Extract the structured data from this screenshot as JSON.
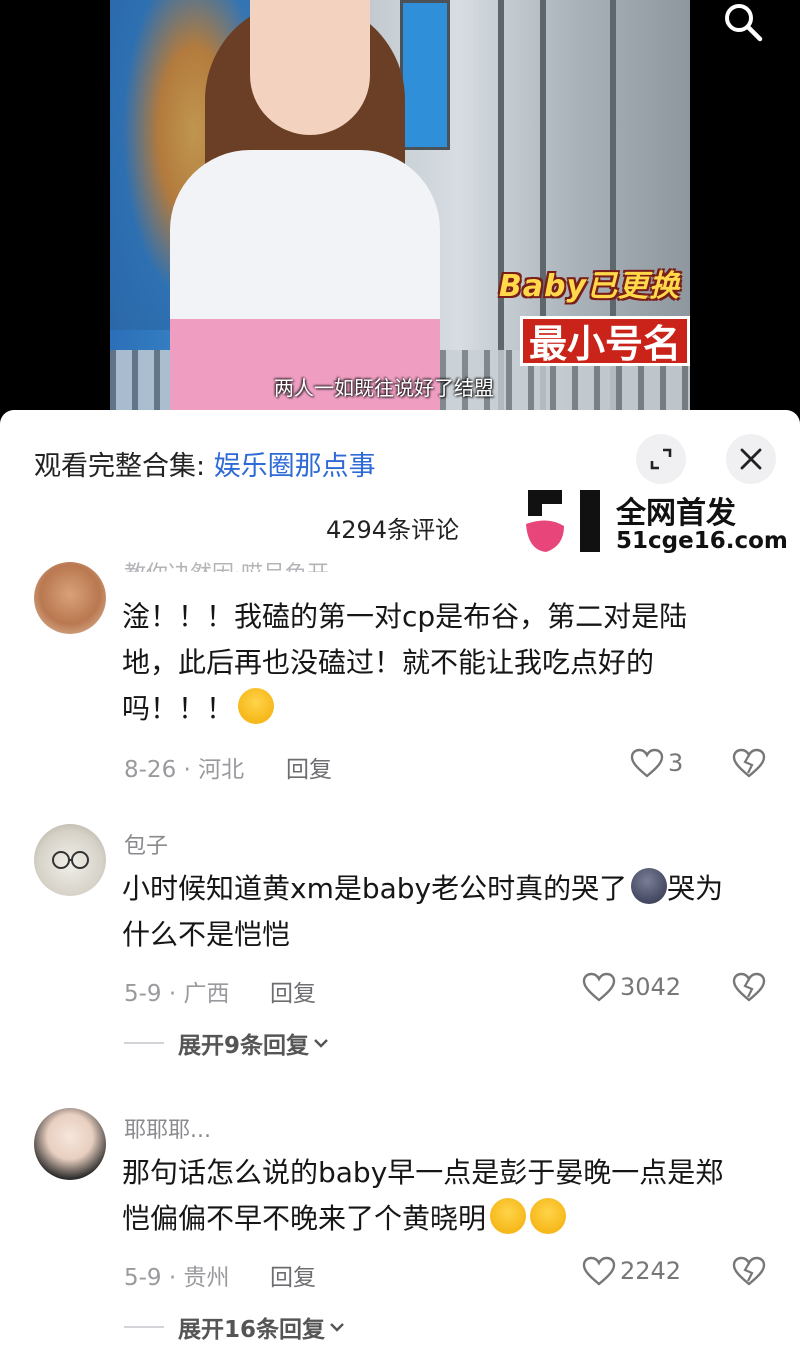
{
  "video": {
    "overlay_tag": "Baby已更换",
    "overlay_big": "最小号名",
    "subtitle": "两人一如既往说好了结盟"
  },
  "sheet": {
    "collection_prefix": "观看完整合集: ",
    "collection_name": "娱乐圈那点事",
    "comment_count": "4294条评论"
  },
  "watermark": {
    "title": "全网首发",
    "url": "51cge16.com"
  },
  "comments": [
    {
      "username": "教你决然因·哎呈色开",
      "text_lines": [
        "淦！！！我磕的第一对cp是布谷，第二对是陆",
        "地，此后再也没磕过！就不能让我吃点好的",
        "吗！！！"
      ],
      "date_location": "8-26 · 河北",
      "reply_label": "回复",
      "likes": "3"
    },
    {
      "username": "包子",
      "text_lines": [
        "小时候知道黄xm是baby老公时真的哭了",
        "哭为",
        "什么不是恺恺"
      ],
      "date_location": "5-9 · 广西",
      "reply_label": "回复",
      "likes": "3042",
      "expand_label": "展开9条回复"
    },
    {
      "username": "耶耶耶...",
      "text_lines": [
        "那句话怎么说的baby早一点是彭于晏晚一点是郑",
        "恺偏偏不早不晚来了个黄晓明"
      ],
      "date_location": "5-9 · 贵州",
      "reply_label": "回复",
      "likes": "2242",
      "expand_label": "展开16条回复"
    }
  ],
  "colors": {
    "link": "#2f6bd6",
    "meta": "#9a9a9e",
    "overlay_red": "#c9231a",
    "watermark_pink": "#e8457a"
  },
  "icons": [
    "search-icon",
    "expand-icon",
    "close-icon",
    "heart-icon",
    "dislike-heart-icon",
    "chevron-down-icon",
    "laughing-emoji",
    "sad-emoji"
  ]
}
